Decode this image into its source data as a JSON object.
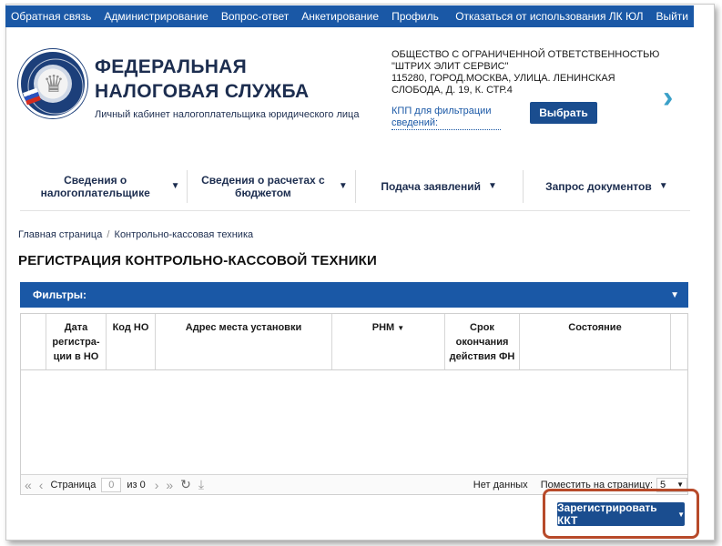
{
  "topbar": {
    "links": [
      "Обратная связь",
      "Администрирование",
      "Вопрос-ответ",
      "Анкетирование",
      "Профиль"
    ],
    "right_links": [
      "Отказаться от использования ЛК ЮЛ",
      "Выйти"
    ],
    "color": "#1a58a6"
  },
  "header": {
    "title_line1": "ФЕДЕРАЛЬНАЯ",
    "title_line2": "НАЛОГОВАЯ СЛУЖБА",
    "subtitle": "Личный кабинет налогоплательщика юридического лица",
    "emblem_icon": "fns-emblem-icon",
    "company_name": "ОБЩЕСТВО С ОГРАНИЧЕННОЙ ОТВЕТСТВЕННОСТЬЮ \"ШТРИХ ЭЛИТ СЕРВИС\"",
    "company_address": "115280, ГОРОД.МОСКВА, УЛИЦА. ЛЕНИНСКАЯ СЛОБОДА, д. 19, к. СТР.4",
    "kpp_link": "КПП для фильтрации сведений:",
    "select_button": "Выбрать",
    "next_icon": "chevron-right-icon"
  },
  "nav": {
    "items": [
      {
        "label": "Сведения о налогоплательщике"
      },
      {
        "label": "Сведения о расчетах с бюджетом"
      },
      {
        "label": "Подача заявлений"
      },
      {
        "label": "Запрос документов"
      }
    ]
  },
  "breadcrumb": {
    "items": [
      "Главная страница",
      "Контрольно-кассовая техника"
    ],
    "separator": "/"
  },
  "page": {
    "title": "РЕГИСТРАЦИЯ КОНТРОЛЬНО-КАССОВОЙ ТЕХНИКИ"
  },
  "filters": {
    "label": "Фильтры:"
  },
  "table": {
    "columns": [
      "",
      "Дата регистра-ции в НО",
      "Код НО",
      "Адрес места установки",
      "РНМ",
      "Срок окончания действия ФН",
      "Состояние",
      ""
    ],
    "rows": []
  },
  "pager": {
    "page_label": "Страница",
    "page_value": "0",
    "of_label": "из 0",
    "no_data": "Нет данных",
    "per_page_label": "Поместить на страницу:",
    "per_page_value": "5"
  },
  "actions": {
    "register_button": "Зарегистрировать ККТ",
    "highlight_color": "#b74a2a"
  }
}
